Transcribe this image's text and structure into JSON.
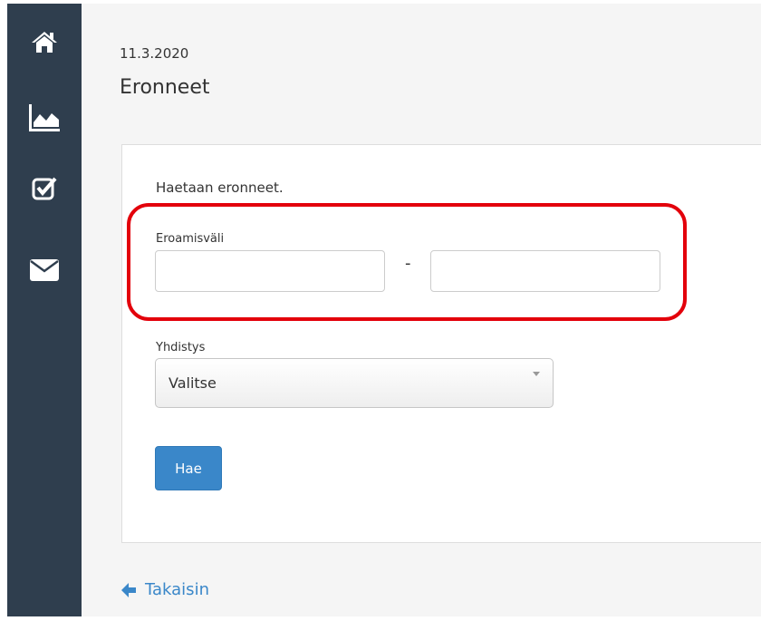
{
  "sidebar": {
    "items": [
      {
        "icon": "home-icon"
      },
      {
        "icon": "area-chart-icon"
      },
      {
        "icon": "checkbox-icon"
      },
      {
        "icon": "envelope-icon"
      }
    ]
  },
  "header": {
    "date": "11.3.2020",
    "title": "Eronneet"
  },
  "form": {
    "intro": "Haetaan eronneet.",
    "range_label": "Eroamisväli",
    "range_separator": "-",
    "range_start_value": "",
    "range_end_value": "",
    "association_label": "Yhdistys",
    "association_selected": "Valitse",
    "submit_label": "Hae"
  },
  "footer": {
    "back_label": "Takaisin"
  },
  "colors": {
    "sidebar_bg": "#2f3e4e",
    "accent": "#3a87c9",
    "highlight": "#e3000b"
  }
}
